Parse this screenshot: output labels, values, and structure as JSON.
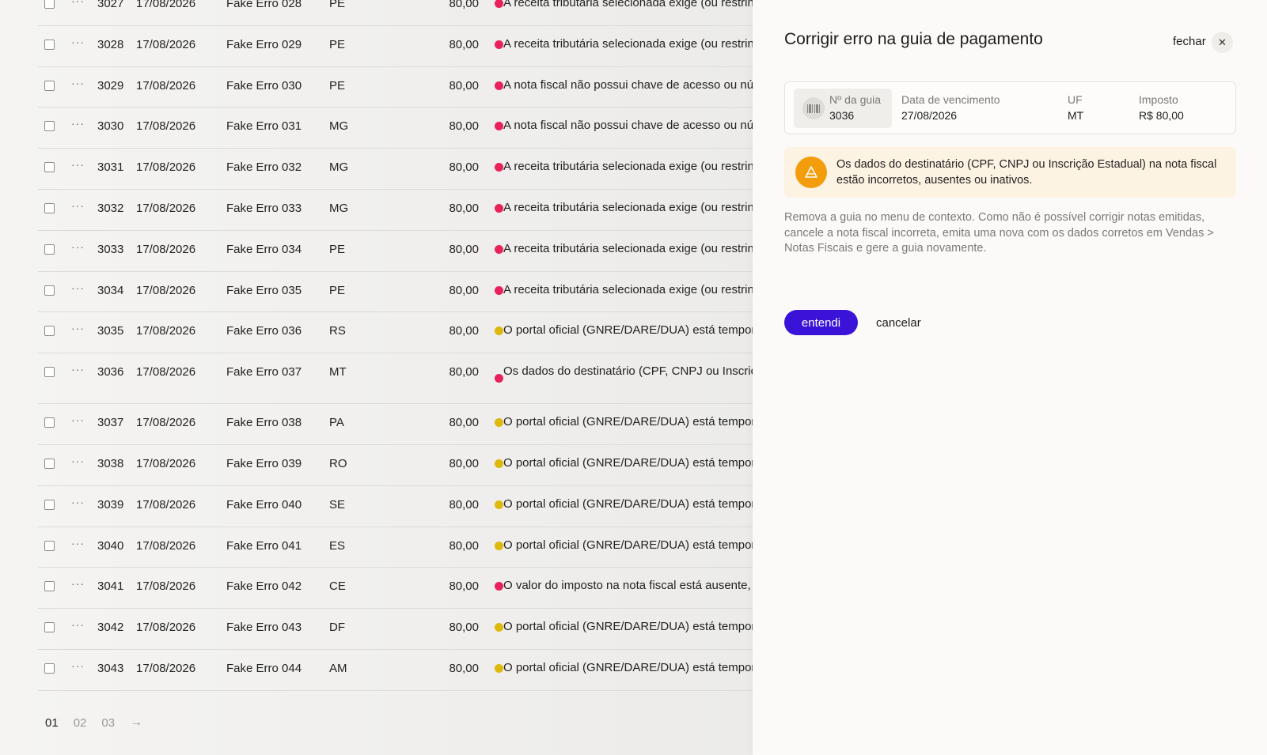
{
  "table": {
    "rows": [
      {
        "id": "3027",
        "date": "17/08/2026",
        "name": "Fake Erro 028",
        "uf": "PE",
        "value": "80,00",
        "status": "red",
        "message": "A receita tributária selecionada exige (ou restringe) a"
      },
      {
        "id": "3028",
        "date": "17/08/2026",
        "name": "Fake Erro 029",
        "uf": "PE",
        "value": "80,00",
        "status": "red",
        "message": "A receita tributária selecionada exige (ou restringe) a"
      },
      {
        "id": "3029",
        "date": "17/08/2026",
        "name": "Fake Erro 030",
        "uf": "PE",
        "value": "80,00",
        "status": "red",
        "message": "A nota fiscal não possui chave de acesso ou número"
      },
      {
        "id": "3030",
        "date": "17/08/2026",
        "name": "Fake Erro 031",
        "uf": "MG",
        "value": "80,00",
        "status": "red",
        "message": "A nota fiscal não possui chave de acesso ou número"
      },
      {
        "id": "3031",
        "date": "17/08/2026",
        "name": "Fake Erro 032",
        "uf": "MG",
        "value": "80,00",
        "status": "red",
        "message": "A receita tributária selecionada exige (ou restringe) a"
      },
      {
        "id": "3032",
        "date": "17/08/2026",
        "name": "Fake Erro 033",
        "uf": "MG",
        "value": "80,00",
        "status": "red",
        "message": "A receita tributária selecionada exige (ou restringe) a"
      },
      {
        "id": "3033",
        "date": "17/08/2026",
        "name": "Fake Erro 034",
        "uf": "PE",
        "value": "80,00",
        "status": "red",
        "message": "A receita tributária selecionada exige (ou restringe) a"
      },
      {
        "id": "3034",
        "date": "17/08/2026",
        "name": "Fake Erro 035",
        "uf": "PE",
        "value": "80,00",
        "status": "red",
        "message": "A receita tributária selecionada exige (ou restringe) a"
      },
      {
        "id": "3035",
        "date": "17/08/2026",
        "name": "Fake Erro 036",
        "uf": "RS",
        "value": "80,00",
        "status": "yellow",
        "message": "O portal oficial (GNRE/DARE/DUA) está temporariam"
      },
      {
        "id": "3036",
        "date": "17/08/2026",
        "name": "Fake Erro 037",
        "uf": "MT",
        "value": "80,00",
        "status": "red",
        "message": "Os dados do destinatário (CPF, CNPJ ou Inscrição Es inativos.",
        "tall": true
      },
      {
        "id": "3037",
        "date": "17/08/2026",
        "name": "Fake Erro 038",
        "uf": "PA",
        "value": "80,00",
        "status": "yellow",
        "message": "O portal oficial (GNRE/DARE/DUA) está temporariam"
      },
      {
        "id": "3038",
        "date": "17/08/2026",
        "name": "Fake Erro 039",
        "uf": "RO",
        "value": "80,00",
        "status": "yellow",
        "message": "O portal oficial (GNRE/DARE/DUA) está temporariam"
      },
      {
        "id": "3039",
        "date": "17/08/2026",
        "name": "Fake Erro 040",
        "uf": "SE",
        "value": "80,00",
        "status": "yellow",
        "message": "O portal oficial (GNRE/DARE/DUA) está temporariam"
      },
      {
        "id": "3040",
        "date": "17/08/2026",
        "name": "Fake Erro 041",
        "uf": "ES",
        "value": "80,00",
        "status": "yellow",
        "message": "O portal oficial (GNRE/DARE/DUA) está temporariam"
      },
      {
        "id": "3041",
        "date": "17/08/2026",
        "name": "Fake Erro 042",
        "uf": "CE",
        "value": "80,00",
        "status": "red",
        "message": "O valor do imposto na nota fiscal está ausente, zerac"
      },
      {
        "id": "3042",
        "date": "17/08/2026",
        "name": "Fake Erro 043",
        "uf": "DF",
        "value": "80,00",
        "status": "yellow",
        "message": "O portal oficial (GNRE/DARE/DUA) está temporariam"
      },
      {
        "id": "3043",
        "date": "17/08/2026",
        "name": "Fake Erro 044",
        "uf": "AM",
        "value": "80,00",
        "status": "yellow",
        "message": "O portal oficial (GNRE/DARE/DUA) está temporariam"
      }
    ],
    "row_menu_glyph": "···"
  },
  "pagination": {
    "pages": [
      "01",
      "02",
      "03"
    ],
    "active": "01",
    "next_glyph": "→"
  },
  "panel": {
    "title": "Corrigir erro na guia de pagamento",
    "close_label": "fechar",
    "close_glyph": "✕",
    "guia": {
      "label": "Nº da guia",
      "value": "3036"
    },
    "due_date": {
      "label": "Data de vencimento",
      "value": "27/08/2026"
    },
    "uf": {
      "label": "UF",
      "value": "MT"
    },
    "tax": {
      "label": "Imposto",
      "value": "R$ 80,00"
    },
    "alert": {
      "text": "Os dados do destinatário (CPF, CNPJ ou Inscrição Estadual) na nota fiscal estão incorretos, ausentes ou inativos.",
      "color": "#f49d0c"
    },
    "description": "Remova a guia no menu de contexto. Como não é possível corrigir notas emitidas, cancele a nota fiscal incorreta, emita uma nova com os dados corretos em Vendas > Notas Fiscais e gere a guia novamente.",
    "primary_button": "entendi",
    "secondary_button": "cancelar",
    "accent_color": "#3a12d8"
  }
}
